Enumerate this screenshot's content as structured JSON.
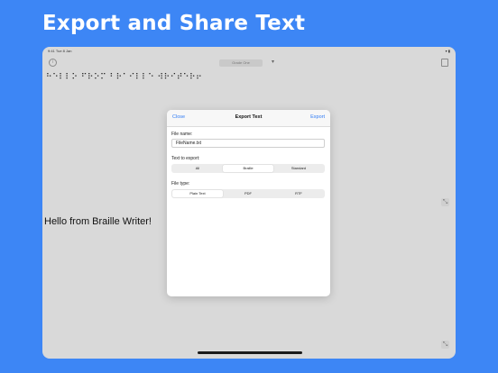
{
  "headline": "Export and Share Text",
  "status": {
    "time": "9:41  Tue 8 Jan",
    "right": "▾ ▮"
  },
  "toolbar": {
    "grade_selector": "Grade One",
    "chevron": "▾",
    "info_glyph": "i"
  },
  "braille_line": "⠓⠑⠇⠇⠕ ⠋⠗⠕⠍ ⠃⠗⠁⠊⠇⠇⠑ ⠺⠗⠊⠞⠑⠗⠖",
  "body_text": "Hello from Braille Writer!",
  "resize_glyph": "⤡",
  "modal": {
    "close_label": "Close",
    "title": "Export Text",
    "export_label": "Export",
    "file_name_label": "File name:",
    "file_name_value": "FileName.txt",
    "text_to_export_label": "Text to export:",
    "text_to_export_options": [
      "All",
      "Braille",
      "Standard"
    ],
    "text_to_export_selected": "Braille",
    "file_type_label": "File type:",
    "file_type_options": [
      "Plain Text",
      "PDF",
      "RTF"
    ],
    "file_type_selected": "Plain Text"
  },
  "colors": {
    "background": "#3d86f5",
    "accent": "#2f7bf5",
    "device": "#d9d9d9"
  }
}
